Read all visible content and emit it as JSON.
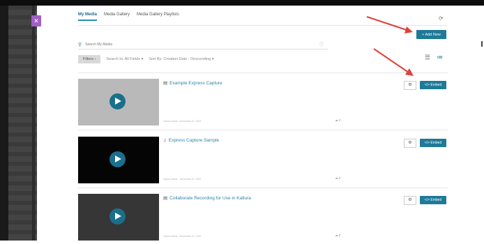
{
  "tabs": [
    {
      "label": "My Media"
    },
    {
      "label": "Media Gallery"
    },
    {
      "label": "Media Gallery Playlists"
    }
  ],
  "actions": {
    "add_new": "+ Add New"
  },
  "search": {
    "placeholder": "Search My Media"
  },
  "filters": {
    "filters_button": "Filters ›",
    "search_in": "Search In: All Fields ▾",
    "sort_by": "Sort By: Creation Date - Descending ▾"
  },
  "media": [
    {
      "title": "Example Express Capture",
      "meta": "Owner Name · December 07, 2022",
      "comments": "0",
      "thumb_color": "#b9b9b9",
      "type_icon": "video-icon",
      "embed_label": "</> Embed"
    },
    {
      "title": "Express Capture Sample",
      "meta": "Owner Name · December 07, 2022",
      "comments": "0",
      "thumb_color": "#050505",
      "type_icon": "audio-icon",
      "embed_label": "</> Embed"
    },
    {
      "title": "Collaborate Recording for Use in Kaltura",
      "meta": "Owner Name · December 07, 2022",
      "comments": "0",
      "thumb_color": "#363636",
      "type_icon": "video-icon",
      "embed_label": "</> Embed"
    }
  ],
  "colors": {
    "accent": "#1e7a98",
    "link": "#2f80a8",
    "arrow": "#e0403b",
    "sidebar_button": "#a25fc7"
  }
}
